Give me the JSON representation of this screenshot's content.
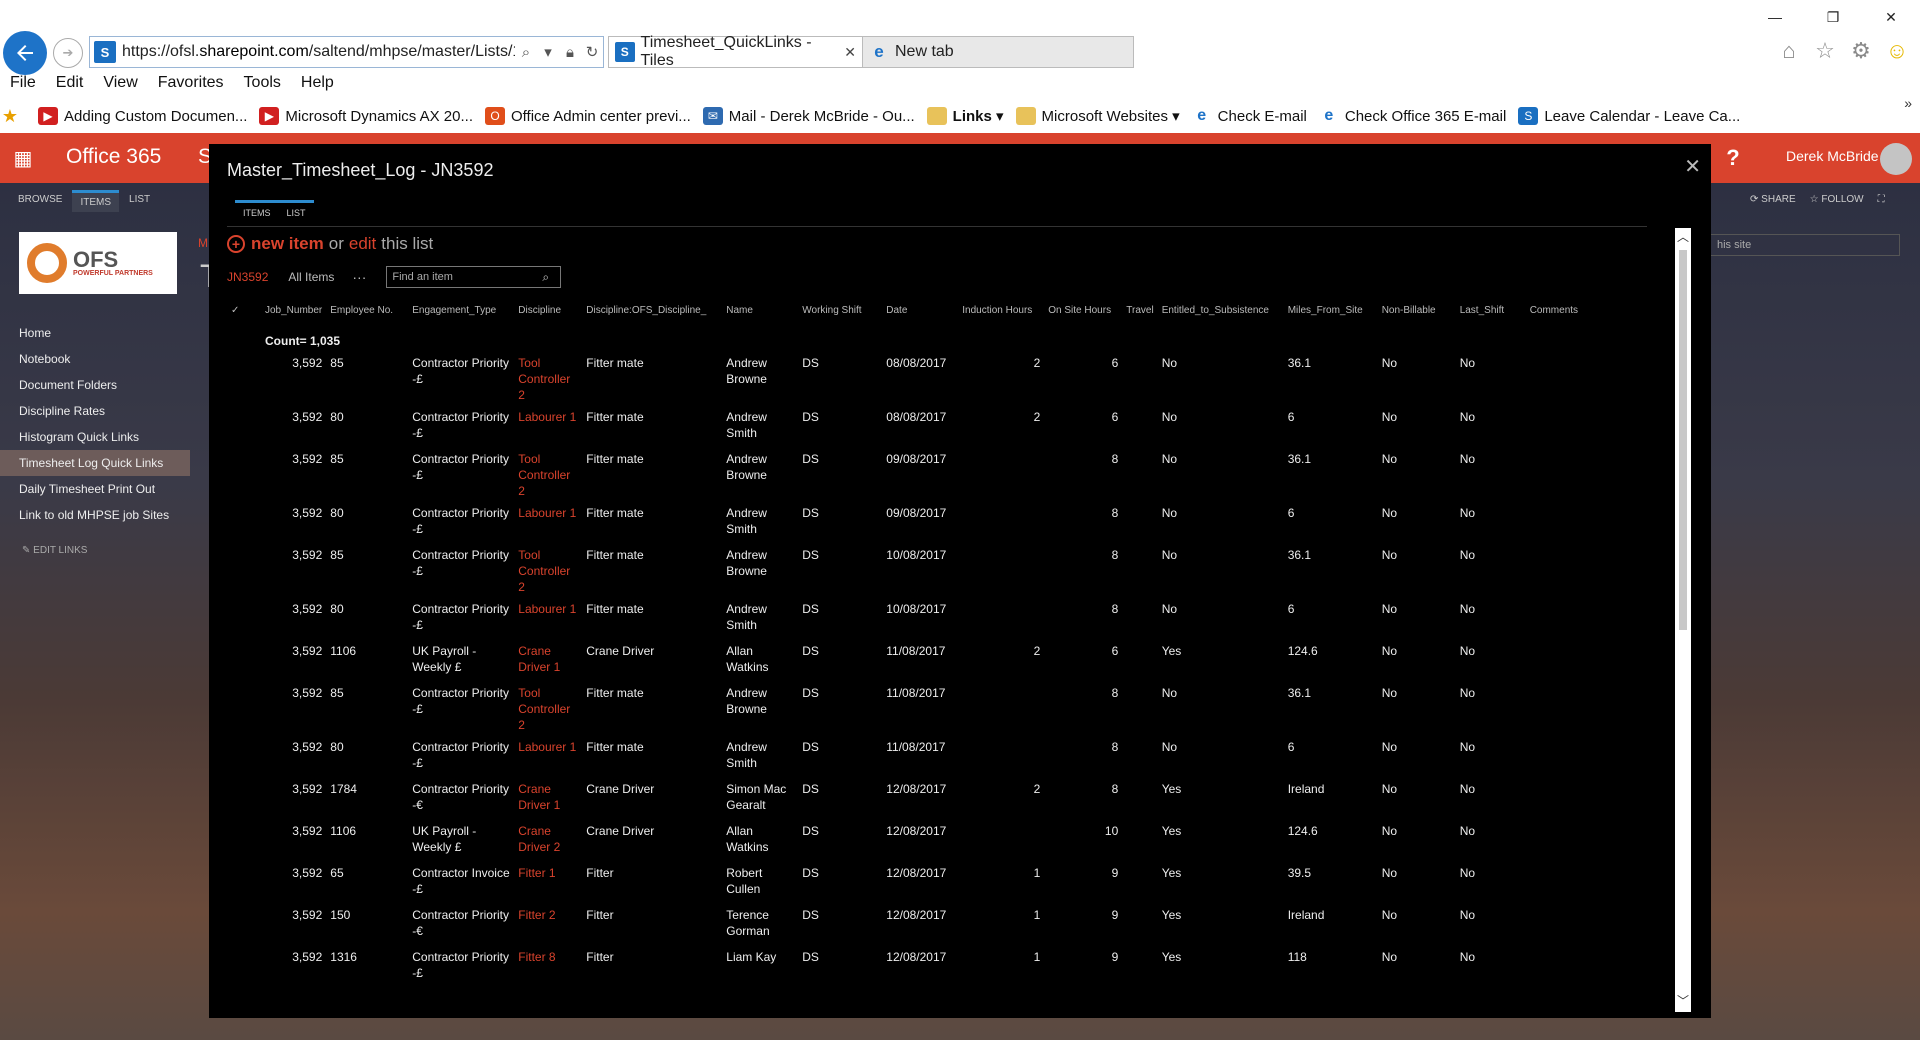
{
  "browser": {
    "url_prefix": "https://ofsl.",
    "url_domain": "sharepoint.com",
    "url_path": "/saltend/mhpse/master/Lists/1",
    "tab_active": "Timesheet_QuickLinks - Tiles",
    "tab_inactive": "New tab",
    "menu": [
      "File",
      "Edit",
      "View",
      "Favorites",
      "Tools",
      "Help"
    ],
    "favorites": [
      {
        "label": "Adding Custom Documen...",
        "icon": "youtube-icon"
      },
      {
        "label": "Microsoft Dynamics AX 20...",
        "icon": "youtube-icon"
      },
      {
        "label": "Office Admin center previ...",
        "icon": "office-icon"
      },
      {
        "label": "Mail - Derek McBride - Ou...",
        "icon": "mail-icon"
      },
      {
        "label": "Links ▾",
        "icon": "folder-icon"
      },
      {
        "label": "Microsoft Websites ▾",
        "icon": "folder-icon"
      },
      {
        "label": "Check E-mail",
        "icon": "ie-icon"
      },
      {
        "label": "Check Office 365 E-mail",
        "icon": "ie-icon"
      },
      {
        "label": "Leave Calendar - Leave Ca...",
        "icon": "sharepoint-icon"
      }
    ]
  },
  "o365": {
    "brand": "Office 365",
    "user": "Derek McBride",
    "help": "?"
  },
  "ribbon": {
    "browse": "BROWSE",
    "items": "ITEMS",
    "list": "LIST",
    "share": "SHARE",
    "follow": "FOLLOW",
    "search_placeholder": "his site"
  },
  "left_nav": {
    "items": [
      "Home",
      "Notebook",
      "Document Folders",
      "Discipline Rates",
      "Histogram Quick Links",
      "Timesheet Log Quick Links",
      "Daily Timesheet Print Out",
      "Link to old MHPSE job Sites"
    ],
    "selected": "Timesheet Log Quick Links",
    "edit_links": "EDIT LINKS"
  },
  "dialog": {
    "title": "Master_Timesheet_Log - JN3592",
    "tab_items": "ITEMS",
    "tab_list": "LIST",
    "new_item": "new item",
    "or": "or",
    "edit": "edit",
    "this_list": "this list",
    "view_current": "JN3592",
    "view_all": "All Items",
    "find_placeholder": "Find an item",
    "count_label": "Count= 1,035",
    "columns": [
      "Job_Number",
      "Employee No.",
      "Engagement_Type",
      "Discipline",
      "Discipline:OFS_Discipline_",
      "Name",
      "Working Shift",
      "Date",
      "Induction Hours",
      "On Site Hours",
      "Travel",
      "Entitled_to_Subsistence",
      "Miles_From_Site",
      "Non-Billable",
      "Last_Shift",
      "Comments"
    ],
    "rows": [
      [
        "3,592",
        "85",
        "Contractor Priority -£",
        "Tool Controller 2",
        "Fitter mate",
        "Andrew Browne",
        "DS",
        "08/08/2017",
        "2",
        "6",
        "",
        "No",
        "36.1",
        "No",
        "No",
        ""
      ],
      [
        "3,592",
        "80",
        "Contractor Priority -£",
        "Labourer 1",
        "Fitter mate",
        "Andrew Smith",
        "DS",
        "08/08/2017",
        "2",
        "6",
        "",
        "No",
        "6",
        "No",
        "No",
        ""
      ],
      [
        "3,592",
        "85",
        "Contractor Priority -£",
        "Tool Controller 2",
        "Fitter mate",
        "Andrew Browne",
        "DS",
        "09/08/2017",
        "",
        "8",
        "",
        "No",
        "36.1",
        "No",
        "No",
        ""
      ],
      [
        "3,592",
        "80",
        "Contractor Priority -£",
        "Labourer 1",
        "Fitter mate",
        "Andrew Smith",
        "DS",
        "09/08/2017",
        "",
        "8",
        "",
        "No",
        "6",
        "No",
        "No",
        ""
      ],
      [
        "3,592",
        "85",
        "Contractor Priority -£",
        "Tool Controller 2",
        "Fitter mate",
        "Andrew Browne",
        "DS",
        "10/08/2017",
        "",
        "8",
        "",
        "No",
        "36.1",
        "No",
        "No",
        ""
      ],
      [
        "3,592",
        "80",
        "Contractor Priority -£",
        "Labourer 1",
        "Fitter mate",
        "Andrew Smith",
        "DS",
        "10/08/2017",
        "",
        "8",
        "",
        "No",
        "6",
        "No",
        "No",
        ""
      ],
      [
        "3,592",
        "1106",
        "UK Payroll - Weekly £",
        "Crane Driver 1",
        "Crane Driver",
        "Allan Watkins",
        "DS",
        "11/08/2017",
        "2",
        "6",
        "",
        "Yes",
        "124.6",
        "No",
        "No",
        ""
      ],
      [
        "3,592",
        "85",
        "Contractor Priority -£",
        "Tool Controller 2",
        "Fitter mate",
        "Andrew Browne",
        "DS",
        "11/08/2017",
        "",
        "8",
        "",
        "No",
        "36.1",
        "No",
        "No",
        ""
      ],
      [
        "3,592",
        "80",
        "Contractor Priority -£",
        "Labourer 1",
        "Fitter mate",
        "Andrew Smith",
        "DS",
        "11/08/2017",
        "",
        "8",
        "",
        "No",
        "6",
        "No",
        "No",
        ""
      ],
      [
        "3,592",
        "1784",
        "Contractor Priority -€",
        "Crane Driver 1",
        "Crane Driver",
        "Simon Mac Gearalt",
        "DS",
        "12/08/2017",
        "2",
        "8",
        "",
        "Yes",
        "Ireland",
        "No",
        "No",
        ""
      ],
      [
        "3,592",
        "1106",
        "UK Payroll - Weekly £",
        "Crane Driver 2",
        "Crane Driver",
        "Allan Watkins",
        "DS",
        "12/08/2017",
        "",
        "10",
        "",
        "Yes",
        "124.6",
        "No",
        "No",
        ""
      ],
      [
        "3,592",
        "65",
        "Contractor Invoice -£",
        "Fitter 1",
        "Fitter",
        "Robert Cullen",
        "DS",
        "12/08/2017",
        "1",
        "9",
        "",
        "Yes",
        "39.5",
        "No",
        "No",
        ""
      ],
      [
        "3,592",
        "150",
        "Contractor Priority -€",
        "Fitter 2",
        "Fitter",
        "Terence Gorman",
        "DS",
        "12/08/2017",
        "1",
        "9",
        "",
        "Yes",
        "Ireland",
        "No",
        "No",
        ""
      ],
      [
        "3,592",
        "1316",
        "Contractor Priority -£",
        "Fitter 8",
        "Fitter",
        "Liam Kay",
        "DS",
        "12/08/2017",
        "1",
        "9",
        "",
        "Yes",
        "118",
        "No",
        "No",
        ""
      ]
    ]
  },
  "colors": {
    "accent": "#d9432d",
    "dialog_bg": "#000000",
    "ribbon_blue": "#2d8ccf"
  }
}
